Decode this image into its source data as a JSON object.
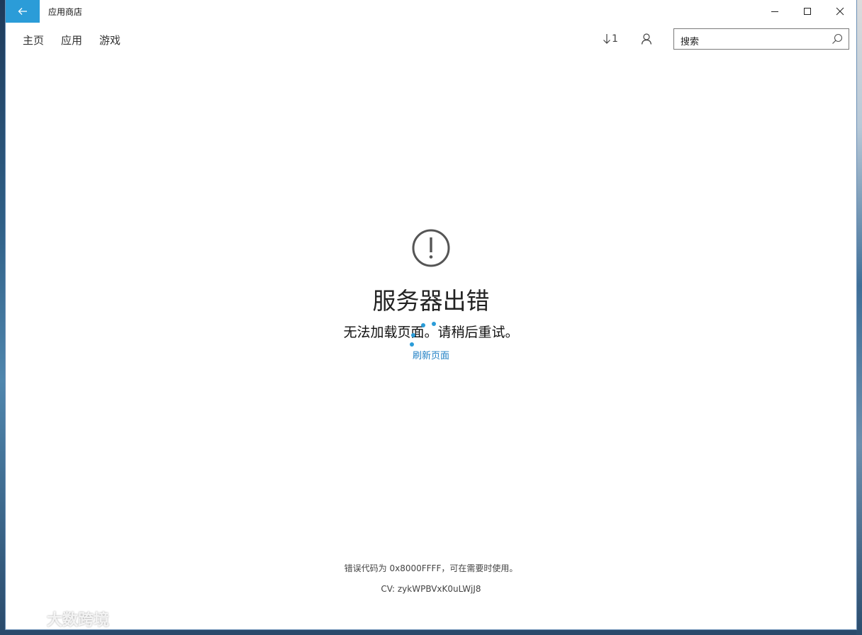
{
  "window": {
    "title": "应用商店"
  },
  "nav": {
    "items": [
      "主页",
      "应用",
      "游戏"
    ],
    "downloads_count": "1",
    "search_placeholder": "搜索"
  },
  "error": {
    "title": "服务器出错",
    "message": "无法加载页面。请稍后重试。",
    "refresh_label": "刷新页面",
    "code_text": "错误代码为 0x8000FFFF，可在需要时使用。",
    "cv_text": "CV: zykWPBVxK0uLWjJ8"
  },
  "watermark": {
    "text": "大数跨境"
  },
  "colors": {
    "accent": "#2b9cd8",
    "link": "#1f7fc4"
  }
}
